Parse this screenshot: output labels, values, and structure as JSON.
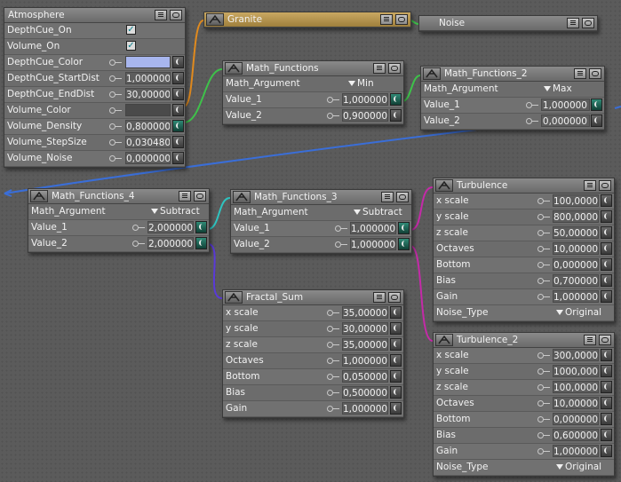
{
  "colors": {
    "wire_orange": "#e08a1e",
    "wire_green": "#3ec24a",
    "wire_teal": "#2ec4c0",
    "wire_purple": "#5a3ad8",
    "wire_magenta": "#c42aa8",
    "wire_blue": "#3a6ed8",
    "granite_title": "#b9984f",
    "depthcue_color": "#a8b6ee",
    "volume_color": "#4a4a4a"
  },
  "nodes": {
    "atmosphere": {
      "title": "Atmosphere",
      "rows": [
        {
          "label": "DepthCue_On",
          "type": "check",
          "checked": true,
          "mark": "✓"
        },
        {
          "label": "Volume_On",
          "type": "check",
          "checked": true,
          "mark": "✓"
        },
        {
          "label": "DepthCue_Color",
          "type": "color",
          "color": "#a8b6ee"
        },
        {
          "label": "DepthCue_StartDist",
          "type": "value",
          "value": "1,000000"
        },
        {
          "label": "DepthCue_EndDist",
          "type": "value",
          "value": "30,000000"
        },
        {
          "label": "Volume_Color",
          "type": "color",
          "color": "#4a4a4a"
        },
        {
          "label": "Volume_Density",
          "type": "value",
          "value": "0,800000"
        },
        {
          "label": "Volume_StepSize",
          "type": "value",
          "value": "0,030480"
        },
        {
          "label": "Volume_Noise",
          "type": "value",
          "value": "0,000000"
        }
      ]
    },
    "granite": {
      "title": "Granite"
    },
    "noise": {
      "title": "Noise"
    },
    "math_functions": {
      "title": "Math_Functions",
      "arg_label": "Math_Argument",
      "arg_value": "Min",
      "v1_label": "Value_1",
      "v1": "1,000000",
      "v2_label": "Value_2",
      "v2": "0,900000"
    },
    "math_functions_2": {
      "title": "Math_Functions_2",
      "arg_label": "Math_Argument",
      "arg_value": "Max",
      "v1_label": "Value_1",
      "v1": "1,000000",
      "v2_label": "Value_2",
      "v2": "0,000000"
    },
    "math_functions_4": {
      "title": "Math_Functions_4",
      "arg_label": "Math_Argument",
      "arg_value": "Subtract",
      "v1_label": "Value_1",
      "v1": "2,000000",
      "v2_label": "Value_2",
      "v2": "2,000000"
    },
    "math_functions_3": {
      "title": "Math_Functions_3",
      "arg_label": "Math_Argument",
      "arg_value": "Subtract",
      "v1_label": "Value_1",
      "v1": "1,000000",
      "v2_label": "Value_2",
      "v2": "1,000000"
    },
    "turbulence": {
      "title": "Turbulence",
      "rows": [
        {
          "label": "x scale",
          "value": "100,000000"
        },
        {
          "label": "y scale",
          "value": "800,000000"
        },
        {
          "label": "z scale",
          "value": "50,000000"
        },
        {
          "label": "Octaves",
          "value": "10,000000"
        },
        {
          "label": "Bottom",
          "value": "0,000000"
        },
        {
          "label": "Bias",
          "value": "0,700000"
        },
        {
          "label": "Gain",
          "value": "1,000000"
        }
      ],
      "type_label": "Noise_Type",
      "type_value": "Original"
    },
    "turbulence_2": {
      "title": "Turbulence_2",
      "rows": [
        {
          "label": "x scale",
          "value": "300,000000"
        },
        {
          "label": "y scale",
          "value": "1000,000000"
        },
        {
          "label": "z scale",
          "value": "100,000000"
        },
        {
          "label": "Octaves",
          "value": "10,000000"
        },
        {
          "label": "Bottom",
          "value": "0,000000"
        },
        {
          "label": "Bias",
          "value": "0,600000"
        },
        {
          "label": "Gain",
          "value": "1,000000"
        }
      ],
      "type_label": "Noise_Type",
      "type_value": "Original"
    },
    "fractal_sum": {
      "title": "Fractal_Sum",
      "rows": [
        {
          "label": "x scale",
          "value": "35,000000"
        },
        {
          "label": "y scale",
          "value": "30,000000"
        },
        {
          "label": "z scale",
          "value": "35,000000"
        },
        {
          "label": "Octaves",
          "value": "1,000000"
        },
        {
          "label": "Bottom",
          "value": "0,050000"
        },
        {
          "label": "Bias",
          "value": "0,500000"
        },
        {
          "label": "Gain",
          "value": "1,000000"
        }
      ]
    }
  }
}
